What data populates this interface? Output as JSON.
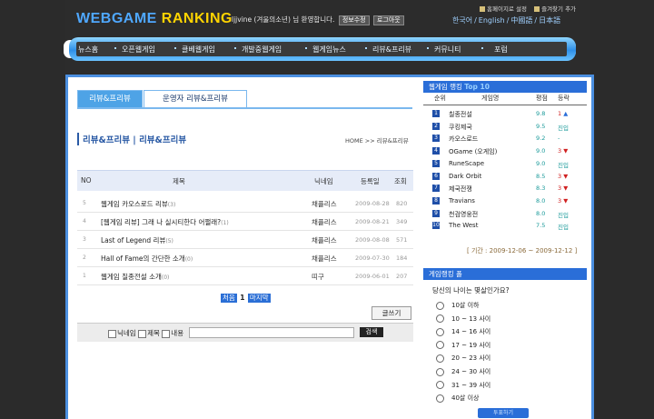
{
  "header": {
    "logo_part1": "WEBGAME",
    "logo_part2": "RANKING",
    "welcome": "ljjvine (겨울의소년) 님 환영합니다.",
    "btn_info": "정보수정",
    "btn_logout": "로그아웃",
    "toplink_home": "홈페이지로 설정",
    "toplink_fav": "즐겨찾기 추가",
    "lang_ko": "한국어",
    "lang_en": "English",
    "lang_zh": "中國語",
    "lang_ja": "日本語"
  },
  "nav": {
    "items": [
      "뉴스홈",
      "오픈웹게임",
      "클베웹게임",
      "개발중웹게임",
      "웹게임뉴스",
      "리뷰&프리뷰",
      "커뮤니티",
      "포럼"
    ]
  },
  "tabs": [
    "리뷰&프리뷰",
    "운영자 리뷰&프리뷰"
  ],
  "section_title": "리뷰&프리뷰 | 리뷰&프리뷰",
  "breadcrumb": "HOME >> 리뷰&프리뷰",
  "table": {
    "headers": [
      "NO",
      "제목",
      "닉네임",
      "등록일",
      "조회"
    ],
    "rows": [
      {
        "no": "5",
        "title": "웹게임 카오스로드 리뷰",
        "count": "(3)",
        "author": "채플리스",
        "date": "2009-08-28",
        "views": "820"
      },
      {
        "no": "4",
        "title": "[웹게임 리뷰] 그래 나 실시티한다 어쩔래?",
        "count": "(1)",
        "author": "채플리스",
        "date": "2009-08-21",
        "views": "349"
      },
      {
        "no": "3",
        "title": "Last of Legend 리뷰",
        "count": "(5)",
        "author": "채플리스",
        "date": "2009-08-08",
        "views": "571"
      },
      {
        "no": "2",
        "title": "Hall of Fame의 간단한 소개",
        "count": "(0)",
        "author": "채플리스",
        "date": "2009-07-30",
        "views": "184"
      },
      {
        "no": "1",
        "title": "웹게임 칠종전설 소개",
        "count": "(0)",
        "author": "띠구",
        "date": "2009-06-01",
        "views": "207"
      }
    ]
  },
  "pager": {
    "first": "처음",
    "current": "1",
    "last": "마지막"
  },
  "write_label": "글쓰기",
  "search": {
    "opt_nick": "닉네임",
    "opt_title": "제목",
    "opt_content": "내용",
    "button": "검색"
  },
  "ranking": {
    "title": "웹게임 랭킹",
    "title_top": "Top 10",
    "headers": [
      "순위",
      "게임명",
      "평점",
      "등락"
    ],
    "rows": [
      {
        "rank": "1",
        "name": "칠종전설",
        "score": "9.8",
        "chg_num": "1",
        "arrow": "▲",
        "dir": "up"
      },
      {
        "rank": "2",
        "name": "쿠킹제국",
        "score": "9.5",
        "chg_num": "",
        "arrow": "진입",
        "dir": "new"
      },
      {
        "rank": "3",
        "name": "카오스로드",
        "score": "9.2",
        "chg_num": "",
        "arrow": "-",
        "dir": "none"
      },
      {
        "rank": "4",
        "name": "OGame (오게임)",
        "score": "9.0",
        "chg_num": "3",
        "arrow": "▼",
        "dir": "down"
      },
      {
        "rank": "5",
        "name": "RuneScape",
        "score": "9.0",
        "chg_num": "",
        "arrow": "진입",
        "dir": "new"
      },
      {
        "rank": "6",
        "name": "Dark Orbit",
        "score": "8.5",
        "chg_num": "3",
        "arrow": "▼",
        "dir": "down"
      },
      {
        "rank": "7",
        "name": "제국전쟁",
        "score": "8.3",
        "chg_num": "3",
        "arrow": "▼",
        "dir": "down"
      },
      {
        "rank": "8",
        "name": "Travians",
        "score": "8.0",
        "chg_num": "3",
        "arrow": "▼",
        "dir": "down"
      },
      {
        "rank": "9",
        "name": "천검영웅전",
        "score": "8.0",
        "chg_num": "",
        "arrow": "진입",
        "dir": "new"
      },
      {
        "rank": "10",
        "name": "The West",
        "score": "7.5",
        "chg_num": "",
        "arrow": "진입",
        "dir": "new"
      }
    ],
    "period": "[ 기간 : 2009-12-06 ~ 2009-12-12 ]"
  },
  "poll": {
    "title": "게임랭킹 폴",
    "question": "당신의 나이는 몇살인가요?",
    "options": [
      "10살 이하",
      "10 ~ 13 사이",
      "14 ~ 16 사이",
      "17 ~ 19 사이",
      "20 ~ 23 사이",
      "24 ~ 30 사이",
      "31 ~ 39 사이",
      "40살 이상"
    ],
    "vote_label": "투표하기"
  },
  "colors": {
    "accent": "#2a6ed8",
    "nav_glow": "#8fd6ff",
    "logo_blue": "#4fa8ff",
    "logo_yellow": "#ffd400"
  }
}
